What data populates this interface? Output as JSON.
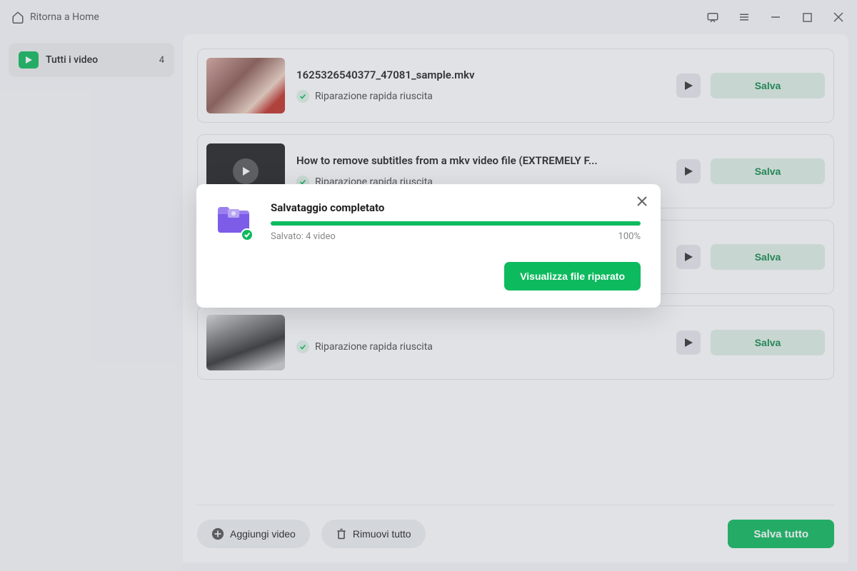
{
  "titlebar": {
    "back_label": "Ritorna a Home"
  },
  "sidebar": {
    "all_videos_label": "Tutti i video",
    "count": "4"
  },
  "videos": [
    {
      "title": "1625326540377_47081_sample.mkv",
      "status": "Riparazione rapida riuscita",
      "save_label": "Salva"
    },
    {
      "title": "How to remove subtitles from a mkv video file (EXTREMELY F...",
      "status": "Riparazione rapida riuscita",
      "save_label": "Salva"
    },
    {
      "title": "",
      "status": "",
      "save_label": "Salva"
    },
    {
      "title": "",
      "status": "Riparazione rapida riuscita",
      "save_label": "Salva"
    }
  ],
  "footer": {
    "add_label": "Aggiungi video",
    "remove_all_label": "Rimuovi tutto",
    "save_all_label": "Salva tutto"
  },
  "dialog": {
    "title": "Salvataggio completato",
    "saved_text": "Salvato: 4 video",
    "percent": "100%",
    "view_label": "Visualizza file riparato"
  }
}
